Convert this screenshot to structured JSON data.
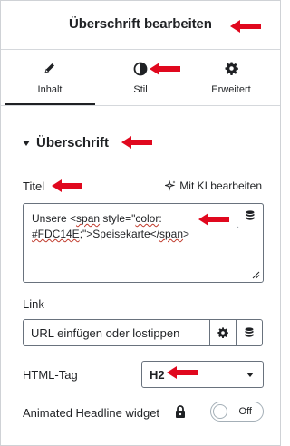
{
  "header": {
    "title": "Überschrift bearbeiten"
  },
  "tabs": [
    {
      "label": "Inhalt",
      "icon": "pencil-icon",
      "active": true
    },
    {
      "label": "Stil",
      "icon": "half-circle-icon",
      "active": false
    },
    {
      "label": "Erweitert",
      "icon": "gear-icon",
      "active": false
    }
  ],
  "section": {
    "title": "Überschrift"
  },
  "title_field": {
    "label": "Titel",
    "ai_link": "Mit KI bearbeiten",
    "value_line1_a": "Unsere <",
    "value_line1_b": "span",
    "value_line1_c": " style=\"",
    "value_line1_d": "color",
    "value_line1_e": ":",
    "value_line2_a": "#FDC14E",
    "value_line2_b": ";\">Speisekarte</",
    "value_line2_c": "span",
    "value_line2_d": ">"
  },
  "link_field": {
    "label": "Link",
    "placeholder": "URL einfügen oder lostippen"
  },
  "html_tag": {
    "label": "HTML-Tag",
    "value": "H2"
  },
  "animated": {
    "label": "Animated Headline widget",
    "toggle_text": "Off"
  },
  "colors": {
    "arrow": "#e0081e",
    "text": "#1f2124",
    "border": "#69727d"
  }
}
